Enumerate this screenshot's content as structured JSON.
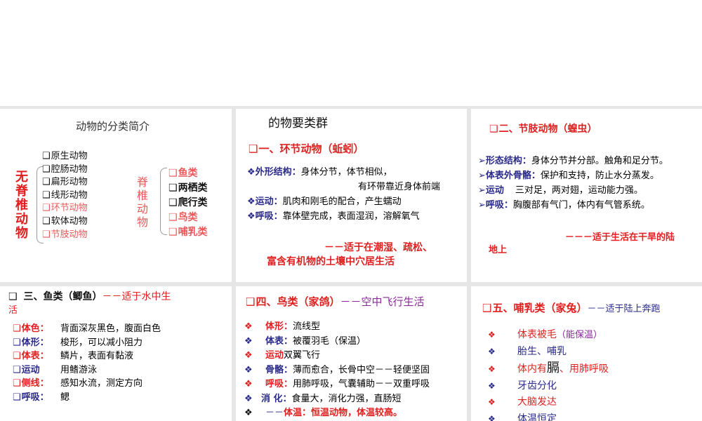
{
  "p1": {
    "title": "动物的分类简介",
    "invert_label": "无脊椎动物",
    "invert": [
      {
        "t": "原生动物",
        "c": "blk"
      },
      {
        "t": "腔肠动物",
        "c": "blk"
      },
      {
        "t": "扁形动物",
        "c": "blk"
      },
      {
        "t": "线形动物",
        "c": "blk"
      },
      {
        "t": "环节动物",
        "c": "pink"
      },
      {
        "t": "软体动物",
        "c": "blk"
      },
      {
        "t": "节肢动物",
        "c": "pink"
      }
    ],
    "vert_label": "脊椎动物",
    "vert": [
      {
        "t": "鱼类",
        "c": "pink"
      },
      {
        "t": "两栖类",
        "c": "blk"
      },
      {
        "t": "爬行类",
        "c": "blk"
      },
      {
        "t": "鸟类",
        "c": "pink"
      },
      {
        "t": "哺乳类",
        "c": "pink"
      }
    ]
  },
  "p2": {
    "title": "的物要类群",
    "heading": "一、环节动物（蚯蚓）",
    "items": [
      {
        "k": "外形结构：",
        "v": "身体分节，体节相似，"
      },
      {
        "k": "",
        "v": "有环带靠近身体前端"
      },
      {
        "k": "运动：",
        "v": "肌肉和刚毛的配合，产生蠕动"
      },
      {
        "k": "呼吸：",
        "v": "靠体壁完成，表面湿润，溶解氧气"
      }
    ],
    "note1": "－－适于在潮湿、疏松、",
    "note2": "富含有机物的土壤中穴居生活"
  },
  "p3": {
    "heading": "二、节肢动物（蝗虫）",
    "items": [
      {
        "k": "形态结构：",
        "v": "身体分节并分部。触角和足分节。"
      },
      {
        "k": "体表外骨骼：",
        "v": "保护和支持，防止水分蒸发。"
      },
      {
        "k": "运动",
        "v": "三对足，两对翅，运动能力强。"
      },
      {
        "k": "呼吸：",
        "v": "胸腹部有气门，体内有气管系统。"
      }
    ],
    "note1": "－－－适于生活在干旱的陆",
    "note2": "地上"
  },
  "p4": {
    "heading": "三、鱼类（鲫鱼）",
    "suffix1": "－－适于水中生",
    "suffix2": "活",
    "items": [
      {
        "k": "体色：",
        "v": "背面深灰黑色，腹面白色",
        "c": "red"
      },
      {
        "k": "体形：",
        "v": "梭形，可以减小阻力",
        "c": "navy"
      },
      {
        "k": "体表：",
        "v": "鳞片，表面有黏液",
        "c": "red"
      },
      {
        "k": "运动",
        "v": "用鳍游泳",
        "c": "navy"
      },
      {
        "k": "侧线：",
        "v": "感知水流，测定方向",
        "c": "red"
      },
      {
        "k": "呼吸：",
        "v": "鳃",
        "c": "navy"
      }
    ]
  },
  "p5": {
    "heading": "四、鸟类（家鸽）",
    "suffix": "－－空中飞行生活",
    "items": [
      {
        "k": "体形：",
        "v": "流线型",
        "c": "red"
      },
      {
        "k": "体表：",
        "v": "被覆羽毛（保温）",
        "c": "navy"
      },
      {
        "k": "运动",
        "v": "双翼飞行",
        "c": "red"
      },
      {
        "k": "骨骼：",
        "v": "薄而愈合，长骨中空－－轻便坚固",
        "c": "navy"
      },
      {
        "k": "呼吸：",
        "v": "用肺呼吸，气囊辅助－－双重呼吸",
        "c": "red"
      },
      {
        "k": "消 化：",
        "v": "食量大，消化力强，直肠短",
        "c": "navy"
      }
    ],
    "last_prefix": "－－",
    "last": "体温：恒温动物，体温较高。"
  },
  "p6": {
    "heading": "五、哺乳类（家兔）",
    "suffix": "－－适于陆上奔跑",
    "items": [
      {
        "t": "体表被毛",
        "extra": "（能保温）",
        "c": "red"
      },
      {
        "t": "胎生、哺乳",
        "c": "navy"
      },
      {
        "t": "体内有",
        "mid": "膈",
        "t2": "、用肺呼吸",
        "c": "red"
      },
      {
        "t": "牙齿分化",
        "c": "navy"
      },
      {
        "t": "大脑发达",
        "c": "red"
      },
      {
        "t": "体温恒定",
        "c": "navy"
      }
    ]
  },
  "colors": {
    "red": "#e02020",
    "navy": "#2a2a8a",
    "panel_bg": "#ffffff",
    "gap": "#e6e6e6"
  }
}
